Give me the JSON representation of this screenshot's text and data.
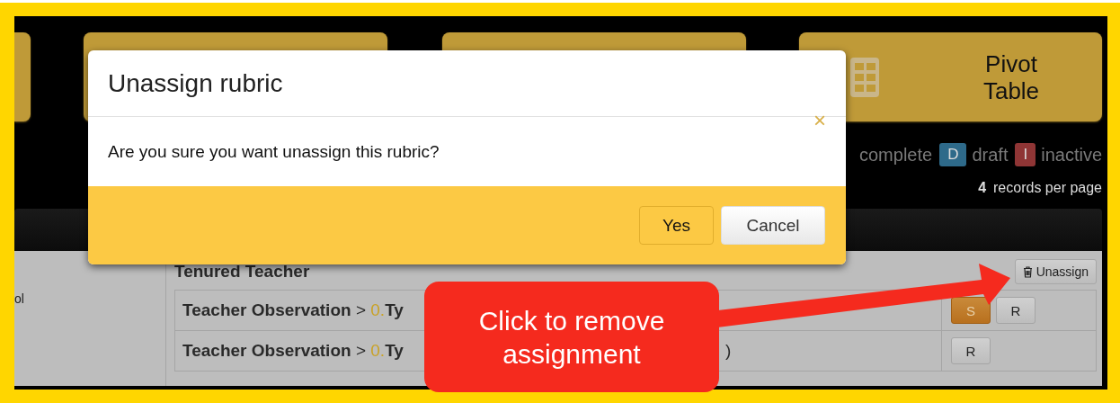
{
  "tiles": [
    {
      "kind": "blank"
    },
    {
      "kind": "blank"
    },
    {
      "kind": "blank"
    },
    {
      "kind": "pivot",
      "label": "Pivot Table"
    }
  ],
  "legend": [
    {
      "label": "complete"
    },
    {
      "badge": "D",
      "color": "#2e6a8a",
      "label": "draft"
    },
    {
      "badge": "I",
      "color": "#8f3535",
      "label": "inactive"
    }
  ],
  "records": {
    "count": "4",
    "label": "records per page"
  },
  "table": {
    "row_label": "ol",
    "group": "Tenured Teacher",
    "unassign": "Unassign",
    "rubrics": [
      {
        "name": "Teacher Observation",
        "separator": ">",
        "number": "0.",
        "rest": "Ty",
        "buttons": [
          {
            "label": "S",
            "selected": true
          },
          {
            "label": "R",
            "selected": false
          }
        ]
      },
      {
        "name": "Teacher Observation",
        "separator": ">",
        "number": "0.",
        "rest": "Ty",
        "suffix": ")",
        "buttons": [
          {
            "label": "R",
            "selected": false
          }
        ]
      }
    ]
  },
  "modal": {
    "title": "Unassign rubric",
    "close": "×",
    "message": "Are you sure you want unassign this rubric?",
    "buttons": [
      {
        "label": "Yes",
        "kind": "primary"
      },
      {
        "label": "Cancel",
        "kind": "default"
      }
    ]
  },
  "callout": {
    "text": "Click to remove assignment"
  }
}
